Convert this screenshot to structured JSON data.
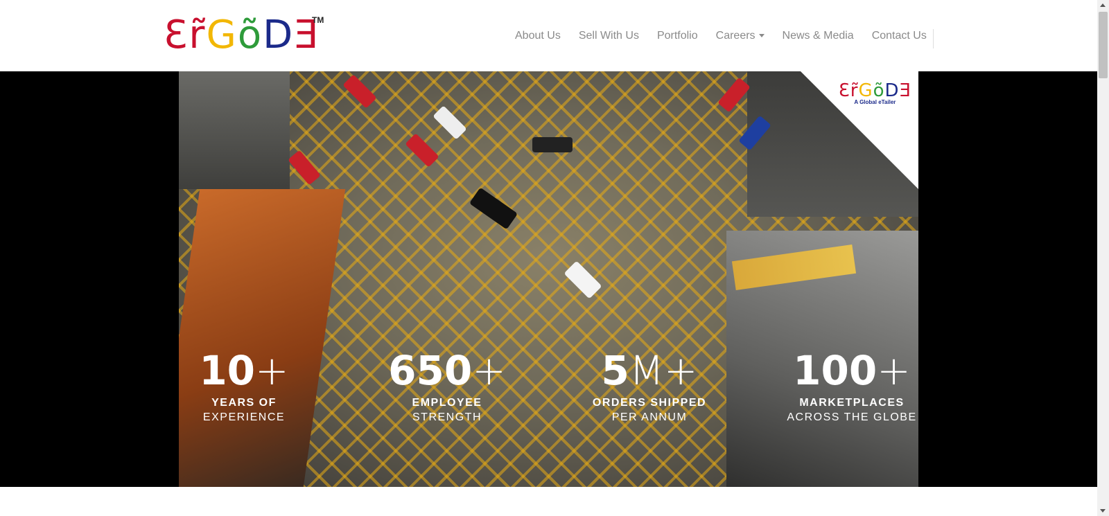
{
  "brand": {
    "letters": [
      {
        "ch": "Ɛ",
        "color": "#c8102e"
      },
      {
        "ch": "r̃",
        "color": "#c8102e"
      },
      {
        "ch": "G",
        "color": "#f2b705"
      },
      {
        "ch": "õ",
        "color": "#2e9b3a"
      },
      {
        "ch": "D",
        "color": "#1b2a8a"
      },
      {
        "ch": "Ǝ",
        "color": "#c8102e"
      }
    ],
    "tm": "TM",
    "mini_tagline": "A Global eTailer"
  },
  "nav": {
    "items": [
      {
        "label": "About Us"
      },
      {
        "label": "Sell With Us"
      },
      {
        "label": "Portfolio"
      },
      {
        "label": "Careers"
      },
      {
        "label": "News & Media"
      },
      {
        "label": "Contact Us"
      }
    ]
  },
  "stats": [
    {
      "value": "10",
      "suffix": "+",
      "line1": "YEARS OF",
      "line2": "EXPERIENCE"
    },
    {
      "value": "650",
      "suffix": "+",
      "line1": "EMPLOYEE",
      "line2": "STRENGTH"
    },
    {
      "value": "5",
      "suffix": "M+",
      "line1": "ORDERS SHIPPED",
      "line2": "PER ANNUM"
    },
    {
      "value": "100",
      "suffix": "+",
      "line1": "MARKETPLACES",
      "line2": "ACROSS THE GLOBE"
    }
  ],
  "colors": {
    "nav_text": "#8a8a8a",
    "hero_bg": "#000000"
  }
}
